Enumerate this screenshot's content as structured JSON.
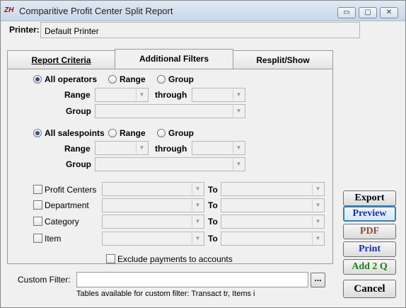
{
  "window": {
    "title": "Comparitive Profit Center Split Report",
    "app_icon_text": "ZH",
    "min_glyph": "▭",
    "max_glyph": "▢",
    "close_glyph": "✕"
  },
  "printer": {
    "label": "Printer:",
    "value": "Default Printer"
  },
  "tabs": [
    {
      "label": "Report Criteria"
    },
    {
      "label": "Additional Filters"
    },
    {
      "label": "Resplit/Show"
    }
  ],
  "operators": {
    "all_label": "All operators",
    "range_label": "Range",
    "group_label": "Group",
    "range_field_label": "Range",
    "through_label": "through",
    "group_field_label": "Group",
    "selected": "all"
  },
  "salespoints": {
    "all_label": "All salespoints",
    "range_label": "Range",
    "group_label": "Group",
    "range_field_label": "Range",
    "through_label": "through",
    "group_field_label": "Group",
    "selected": "all"
  },
  "filters": [
    {
      "label": "Profit Centers",
      "to": "To",
      "checked": false
    },
    {
      "label": "Department",
      "to": "To",
      "checked": false
    },
    {
      "label": "Category",
      "to": "To",
      "checked": false
    },
    {
      "label": "Item",
      "to": "To",
      "checked": false
    }
  ],
  "exclude_payments": {
    "label": "Exclude payments to accounts",
    "checked": false
  },
  "custom_filter": {
    "label": "Custom Filter:",
    "value": "",
    "browse_label": "...",
    "hint": "Tables available for custom filter: Transact tr, Items i"
  },
  "buttons": {
    "export": "Export",
    "preview": "Preview",
    "pdf": "PDF",
    "print": "Print",
    "add2q": "Add 2 Q",
    "cancel": "Cancel"
  },
  "colors": {
    "preview_text": "#1a2fa8",
    "pdf_text": "#8a4a3a",
    "print_text": "#1a2fa8",
    "add2q_text": "#1e7a1e",
    "cancel_text": "#000000"
  },
  "icons": {
    "dropdown": "chevron-down-icon",
    "app": "app-logo-icon"
  }
}
